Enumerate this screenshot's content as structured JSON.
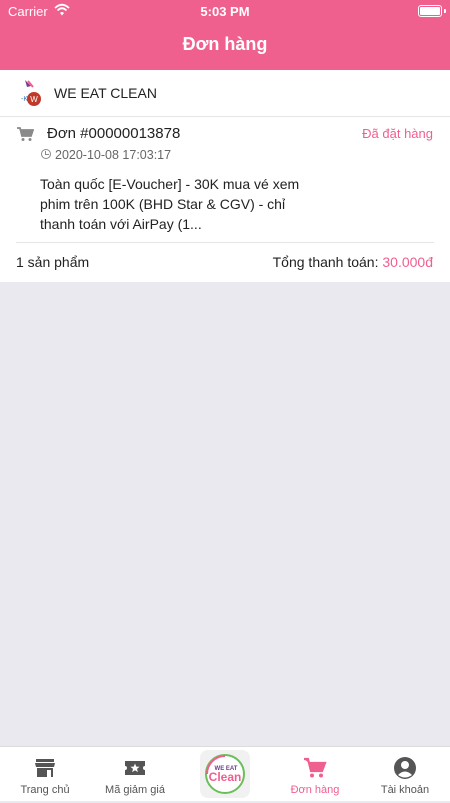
{
  "status_bar": {
    "carrier": "Carrier",
    "time": "5:03 PM"
  },
  "header": {
    "title": "Đơn hàng"
  },
  "shop": {
    "name": "WE EAT CLEAN"
  },
  "order": {
    "id": "Đơn #00000013878",
    "status": "Đã đặt hàng",
    "datetime": "2020-10-08 17:03:17",
    "product": "Toàn quốc [E-Voucher] - 30K mua vé xem phim trên 100K (BHD Star & CGV) - chỉ thanh toán với AirPay (1...",
    "quantity": "1 sản phẩm",
    "total_label": "Tổng thanh toán:",
    "total_amount": "30.000đ"
  },
  "tabs": [
    {
      "label": "Trang chủ",
      "icon": "store-icon"
    },
    {
      "label": "Mã giảm giá",
      "icon": "voucher-icon"
    },
    {
      "label": "",
      "icon": "we-eat-clean-logo"
    },
    {
      "label": "Đơn hàng",
      "icon": "cart-icon",
      "active": true
    },
    {
      "label": "Tài khoản",
      "icon": "account-icon"
    }
  ],
  "colors": {
    "accent": "#f0608f",
    "background": "#e9e9ef"
  }
}
